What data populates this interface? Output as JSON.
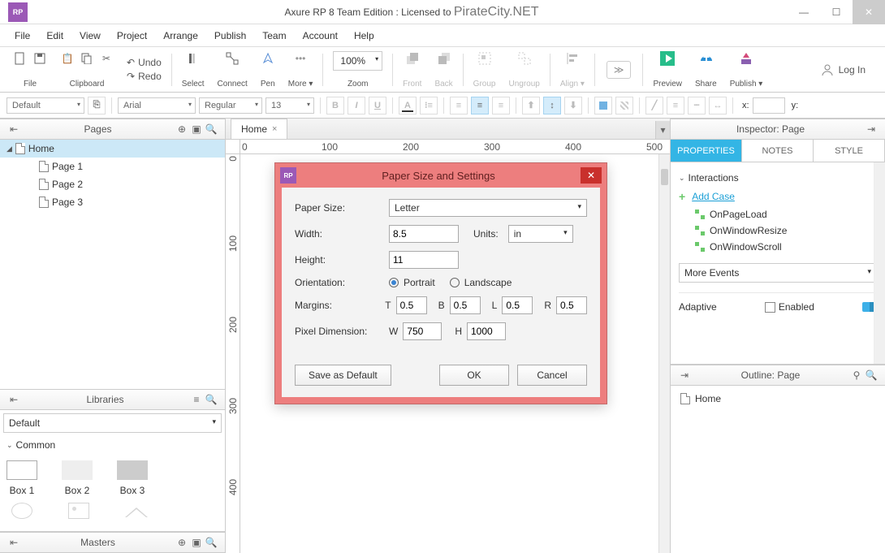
{
  "titlebar": {
    "logo_text": "RP",
    "title_a": "Axure RP 8 Team Edition : Licensed to ",
    "title_b": "PirateCity.NET"
  },
  "menu": [
    "File",
    "Edit",
    "View",
    "Project",
    "Arrange",
    "Publish",
    "Team",
    "Account",
    "Help"
  ],
  "toolbar": {
    "file_label": "File",
    "clipboard_label": "Clipboard",
    "undo": "Undo",
    "redo": "Redo",
    "select": "Select",
    "connect": "Connect",
    "pen": "Pen",
    "more": "More ▾",
    "zoom_value": "100%",
    "zoom_label": "Zoom",
    "front": "Front",
    "back": "Back",
    "group": "Group",
    "ungroup": "Ungroup",
    "align": "Align ▾",
    "preview": "Preview",
    "share": "Share",
    "publish": "Publish ▾",
    "login": "Log In"
  },
  "formatbar": {
    "style": "Default",
    "font": "Arial",
    "weight": "Regular",
    "size": "13",
    "x_label": "x:",
    "y_label": "y:"
  },
  "panels": {
    "pages_title": "Pages",
    "libraries_title": "Libraries",
    "masters_title": "Masters",
    "inspector_title": "Inspector: Page",
    "outline_title": "Outline: Page"
  },
  "pages": {
    "root": "Home",
    "items": [
      "Page 1",
      "Page 2",
      "Page 3"
    ]
  },
  "libraries": {
    "select": "Default",
    "section": "Common",
    "items": [
      "Box 1",
      "Box 2",
      "Box 3"
    ]
  },
  "tabs": {
    "home": "Home"
  },
  "ruler": {
    "h": [
      "0",
      "100",
      "200",
      "300",
      "400",
      "500"
    ],
    "v": [
      "0",
      "100",
      "200",
      "300",
      "400"
    ]
  },
  "inspector": {
    "tabs": [
      "PROPERTIES",
      "NOTES",
      "STYLE"
    ],
    "interactions_label": "Interactions",
    "add_case": "Add Case",
    "events": [
      "OnPageLoad",
      "OnWindowResize",
      "OnWindowScroll"
    ],
    "more_events": "More Events",
    "adaptive": "Adaptive",
    "enabled": "Enabled"
  },
  "outline": {
    "root": "Home"
  },
  "dialog": {
    "title": "Paper Size and Settings",
    "paper_size_label": "Paper Size:",
    "paper_size": "Letter",
    "width_label": "Width:",
    "width": "8.5",
    "units_label": "Units:",
    "units": "in",
    "height_label": "Height:",
    "height": "11",
    "orientation_label": "Orientation:",
    "portrait": "Portrait",
    "landscape": "Landscape",
    "margins_label": "Margins:",
    "m_t_lbl": "T",
    "m_t": "0.5",
    "m_b_lbl": "B",
    "m_b": "0.5",
    "m_l_lbl": "L",
    "m_l": "0.5",
    "m_r_lbl": "R",
    "m_r": "0.5",
    "pixel_label": "Pixel Dimension:",
    "pw_lbl": "W",
    "pw": "750",
    "ph_lbl": "H",
    "ph": "1000",
    "save_default": "Save as Default",
    "ok": "OK",
    "cancel": "Cancel"
  }
}
